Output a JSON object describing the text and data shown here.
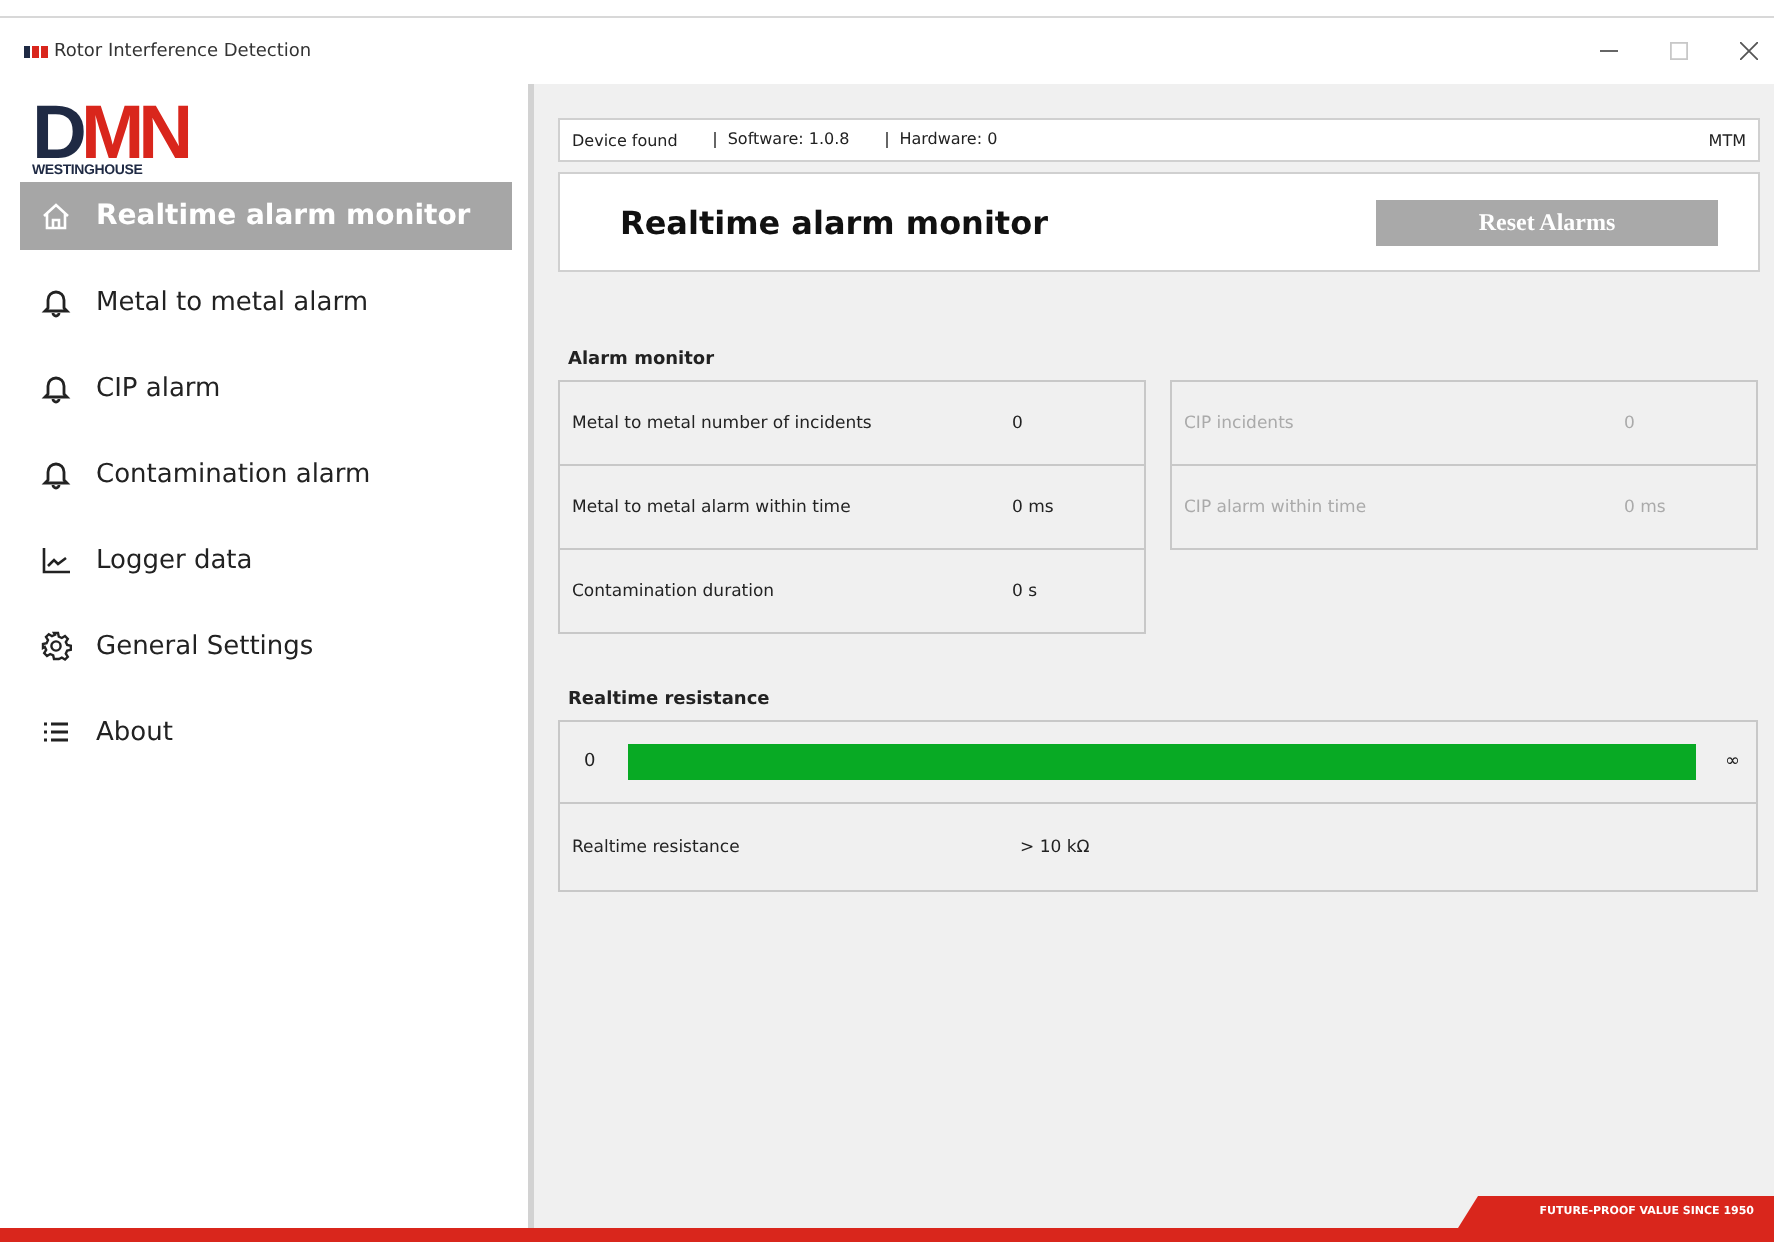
{
  "window": {
    "title": "Rotor Interference Detection"
  },
  "logo": {
    "mark_dark": "D",
    "mark_red": "MN",
    "subtitle": "WESTINGHOUSE"
  },
  "nav": [
    {
      "label": "Realtime alarm monitor",
      "kind": "home",
      "selected": true
    },
    {
      "label": "Metal to metal alarm",
      "kind": "bell",
      "selected": false
    },
    {
      "label": "CIP alarm",
      "kind": "bell",
      "selected": false
    },
    {
      "label": "Contamination alarm",
      "kind": "bell",
      "selected": false
    },
    {
      "label": "Logger data",
      "kind": "chart",
      "selected": false
    },
    {
      "label": "General Settings",
      "kind": "gear",
      "selected": false
    },
    {
      "label": "About",
      "kind": "list",
      "selected": false
    }
  ],
  "status_bar": {
    "items": [
      "Device found",
      "Software: 1.0.8",
      "Hardware: 0"
    ],
    "mode": "MTM"
  },
  "header": {
    "title": "Realtime alarm monitor",
    "button": {
      "label": "Reset Alarms",
      "disabled": true
    }
  },
  "alarm_monitor": {
    "title": "Alarm monitor",
    "panels": [
      [
        {
          "label": "Metal to metal number of incidents",
          "value": "0",
          "disabled": false
        },
        {
          "label": "Metal to metal alarm within time",
          "value": "0 ms",
          "disabled": false
        },
        {
          "label": "Contamination duration",
          "value": "0 s",
          "disabled": false
        }
      ],
      [
        {
          "label": "CIP incidents",
          "value": "0",
          "disabled": true
        },
        {
          "label": "CIP alarm within time",
          "value": "0 ms",
          "disabled": true
        }
      ]
    ]
  },
  "resistance": {
    "title": "Realtime resistance",
    "min_label": "0",
    "max_label": "∞",
    "label": "Realtime resistance",
    "value": "> 10 kΩ"
  },
  "footer": {
    "slogan": "FUTURE-PROOF VALUE SINCE 1950"
  }
}
